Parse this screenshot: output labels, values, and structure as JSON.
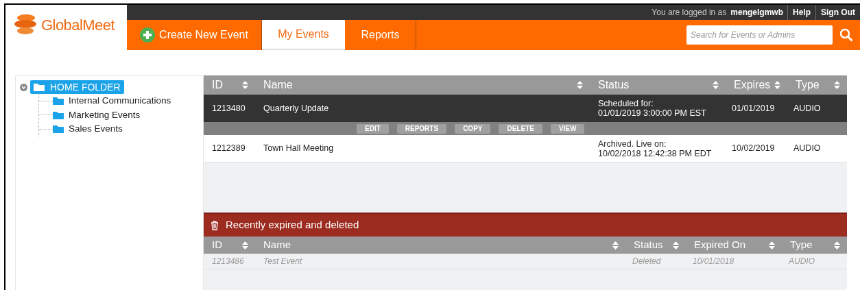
{
  "brand": {
    "name": "GlobalMeet"
  },
  "topbar": {
    "login_text": "You are logged in as",
    "username": "mengelgmwb",
    "links": [
      "Help",
      "Sign Out"
    ]
  },
  "nav": {
    "create_button": "Create New Event",
    "tabs": [
      {
        "label": "My Events",
        "selected": true
      },
      {
        "label": "Reports",
        "selected": false
      }
    ],
    "search": {
      "placeholder": "Search for Events or Admins"
    }
  },
  "tree": {
    "label": "HOME FOLDER",
    "expanded": true,
    "selected": true,
    "children": [
      {
        "label": "Internal Communications"
      },
      {
        "label": "Marketing Events"
      },
      {
        "label": "Sales Events"
      }
    ]
  },
  "events_table": {
    "columns": [
      "ID",
      "Name",
      "Status",
      "Expires",
      "Type"
    ],
    "rows": [
      {
        "id": "1213480",
        "name": "Quarterly Update",
        "status": [
          "Scheduled for:",
          "01/01/2019 3:00:00 PM EST"
        ],
        "expires": "01/01/2019",
        "type": "AUDIO",
        "selected": true
      },
      {
        "id": "1212389",
        "name": "Town Hall Meeting",
        "status": [
          "Archived. Live on:",
          "10/02/2018 12:42:38 PM EDT"
        ],
        "expires": "10/02/2019",
        "type": "AUDIO",
        "selected": false
      }
    ],
    "actions": [
      "EDIT",
      "REPORTS",
      "COPY",
      "DELETE",
      "VIEW"
    ]
  },
  "expired_section": {
    "title": "Recently expired and deleted",
    "columns": [
      "ID",
      "Name",
      "Status",
      "Expired On",
      "Type"
    ],
    "rows": [
      {
        "id": "1213486",
        "name": "Test Event",
        "status": "Deleted",
        "expired_on": "10/01/2018",
        "type": "AUDIO"
      }
    ]
  }
}
